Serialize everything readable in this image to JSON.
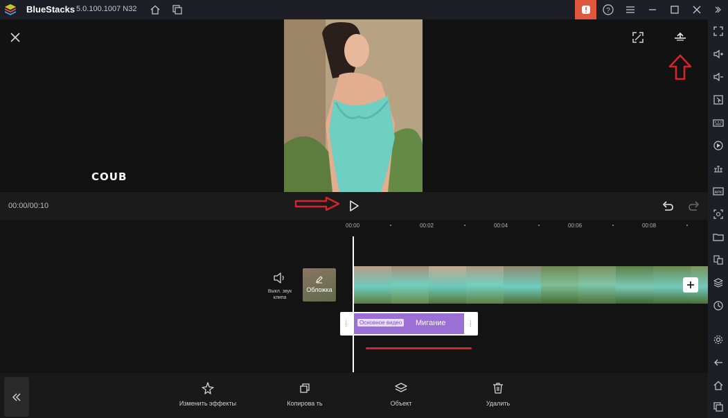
{
  "titlebar": {
    "app_name": "BlueStacks",
    "version": "5.0.100.1007 N32"
  },
  "player": {
    "watermark": "COUB",
    "timecode": "00:00/00:10"
  },
  "timeline": {
    "ruler": [
      "00:00",
      "00:02",
      "00:04",
      "00:06",
      "00:08"
    ],
    "mute_label": "Выкл. звук клипа",
    "cover_label": "Обложка",
    "effect_tag": "Основное видео",
    "effect_name": "Мигание"
  },
  "toolbar": {
    "tools": [
      {
        "label": "Изменить эффекты",
        "icon": "sparkle-icon"
      },
      {
        "label": "Копирова ть",
        "icon": "copy-icon"
      },
      {
        "label": "Объект",
        "icon": "layers-icon"
      },
      {
        "label": "Удалить",
        "icon": "trash-icon"
      }
    ]
  },
  "colors": {
    "accent_red": "#d8232a",
    "effect_purple": "#9b6fd6",
    "alert_orange": "#e0573f"
  }
}
